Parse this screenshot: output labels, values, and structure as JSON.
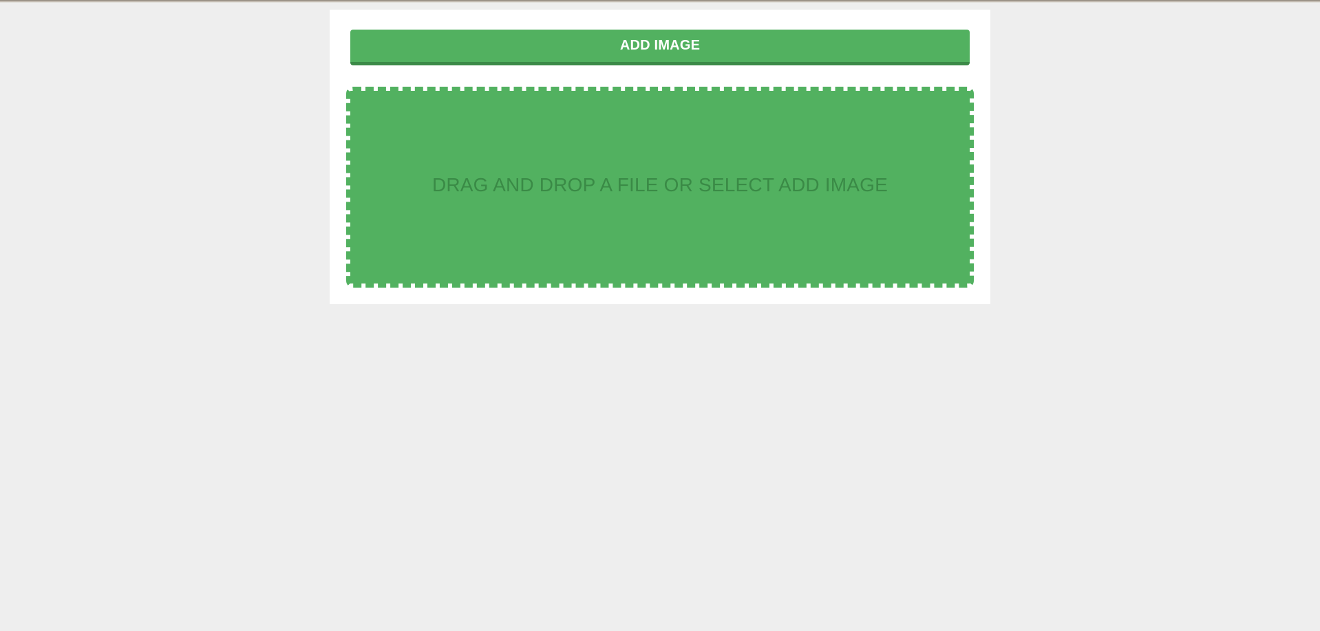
{
  "uploader": {
    "add_button_label": "ADD IMAGE",
    "drop_zone_text": "DRAG AND DROP A FILE OR SELECT ADD IMAGE"
  },
  "colors": {
    "accent": "#52b160",
    "accent_dark": "#3c8a48",
    "drop_text": "#3a8a46",
    "page_background": "#eeeeee",
    "panel_background": "#ffffff"
  }
}
